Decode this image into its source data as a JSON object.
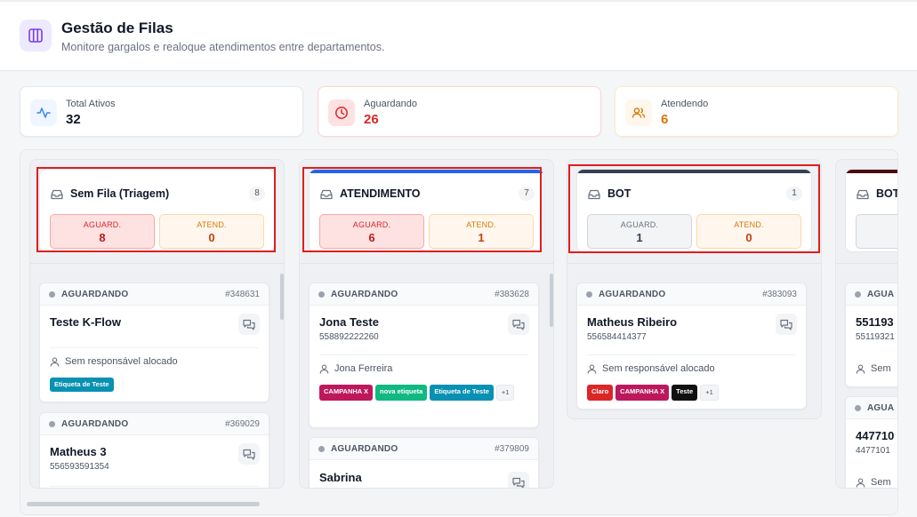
{
  "header": {
    "title": "Gestão de Filas",
    "subtitle": "Monitore gargalos e realoque atendimentos entre departamentos."
  },
  "stats": [
    {
      "label": "Total Ativos",
      "value": "32",
      "color": "#111827",
      "icon": "activity-icon",
      "icon_bg": "#eff6ff",
      "icon_color": "#3b82f6"
    },
    {
      "label": "Aguardando",
      "value": "26",
      "color": "#dc2626",
      "icon": "clock-icon",
      "icon_bg": "#fee2e2",
      "icon_color": "#dc2626"
    },
    {
      "label": "Atendendo",
      "value": "6",
      "color": "#d97706",
      "icon": "users-icon",
      "icon_bg": "#fff7ed",
      "icon_color": "#d97706"
    }
  ],
  "columns": [
    {
      "title": "Sem Fila (Triagem)",
      "count": "8",
      "bar_color": "#ffffff",
      "waiting_label": "AGUARD.",
      "waiting": "8",
      "attending_label": "ATEND.",
      "attending": "0",
      "tickets": [
        {
          "status": "AGUARDANDO",
          "id": "#348631",
          "name": "Teste K-Flow",
          "phone": "",
          "responsible": "Sem responsável alocado",
          "tags": [
            {
              "label": "Etiqueta de Teste",
              "color": "#0891b2"
            }
          ],
          "more": ""
        },
        {
          "status": "AGUARDANDO",
          "id": "#369029",
          "name": "Matheus 3",
          "phone": "556593591354",
          "responsible": "",
          "tags": [],
          "more": ""
        }
      ]
    },
    {
      "title": "ATENDIMENTO",
      "count": "7",
      "bar_color": "#2563eb",
      "waiting_label": "AGUARD.",
      "waiting": "6",
      "attending_label": "ATEND.",
      "attending": "1",
      "tickets": [
        {
          "status": "AGUARDANDO",
          "id": "#383628",
          "name": "Jona Teste",
          "phone": "558892222260",
          "responsible": "Jona Ferreira",
          "tags": [
            {
              "label": "CAMPANHA X",
              "color": "#be185d"
            },
            {
              "label": "nova etiqueta",
              "color": "#10b981"
            },
            {
              "label": "Etiqueta de Teste",
              "color": "#0891b2"
            }
          ],
          "more": "+1"
        },
        {
          "status": "AGUARDANDO",
          "id": "#379809",
          "name": "Sabrina",
          "phone": "",
          "responsible": "",
          "tags": [],
          "more": ""
        }
      ]
    },
    {
      "title": "BOT",
      "count": "1",
      "bar_color": "#374151",
      "waiting_label": "AGUARD.",
      "waiting": "1",
      "attending_label": "ATEND.",
      "attending": "0",
      "tickets": [
        {
          "status": "AGUARDANDO",
          "id": "#383093",
          "name": "Matheus Ribeiro",
          "phone": "556584414377",
          "responsible": "Sem responsável alocado",
          "tags": [
            {
              "label": "Claro",
              "color": "#dc2626"
            },
            {
              "label": "CAMPANHA X",
              "color": "#be185d"
            },
            {
              "label": "Teste",
              "color": "#111111"
            }
          ],
          "more": "+1"
        }
      ]
    },
    {
      "title": "BOT",
      "count": "",
      "bar_color": "#4a0d0d",
      "waiting_label": "A",
      "waiting": "",
      "attending_label": "",
      "attending": "",
      "tickets": [
        {
          "status": "AGUA",
          "id": "",
          "name": "551193",
          "phone": "55119321",
          "responsible": "Sem",
          "tags": [],
          "more": ""
        },
        {
          "status": "AGUA",
          "id": "",
          "name": "447710",
          "phone": "4477101",
          "responsible": "Sem",
          "tags": [],
          "more": ""
        }
      ]
    }
  ]
}
